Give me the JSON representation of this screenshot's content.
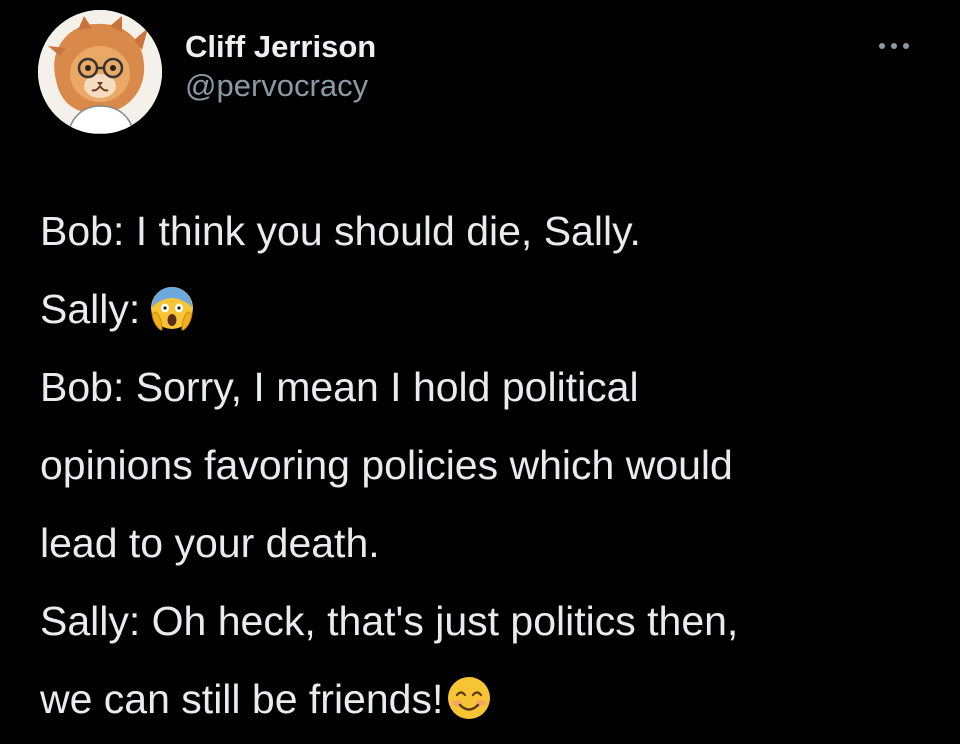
{
  "author": {
    "display_name": "Cliff Jerrison",
    "handle": "@pervocracy",
    "avatar_icon": "cartoon-cat-with-glasses-avatar"
  },
  "more_icon": "more-options-icon",
  "tweet": {
    "lines": [
      {
        "text": "Bob: I think you should die, Sally."
      },
      {
        "text": "Sally:",
        "emoji": "face-screaming-in-fear-emoji"
      },
      {
        "text": "Bob: Sorry, I mean I hold political"
      },
      {
        "text": "opinions favoring policies which would"
      },
      {
        "text": "lead to your death."
      },
      {
        "text": "Sally: Oh heck, that's just politics then,"
      },
      {
        "text": "we can still be friends!",
        "emoji": "smiling-face-with-smiling-eyes-emoji"
      }
    ]
  },
  "colors": {
    "background": "#000000",
    "text": "#e9ebec",
    "handle": "#8b98a5",
    "emoji_yellow": "#f7c433"
  }
}
